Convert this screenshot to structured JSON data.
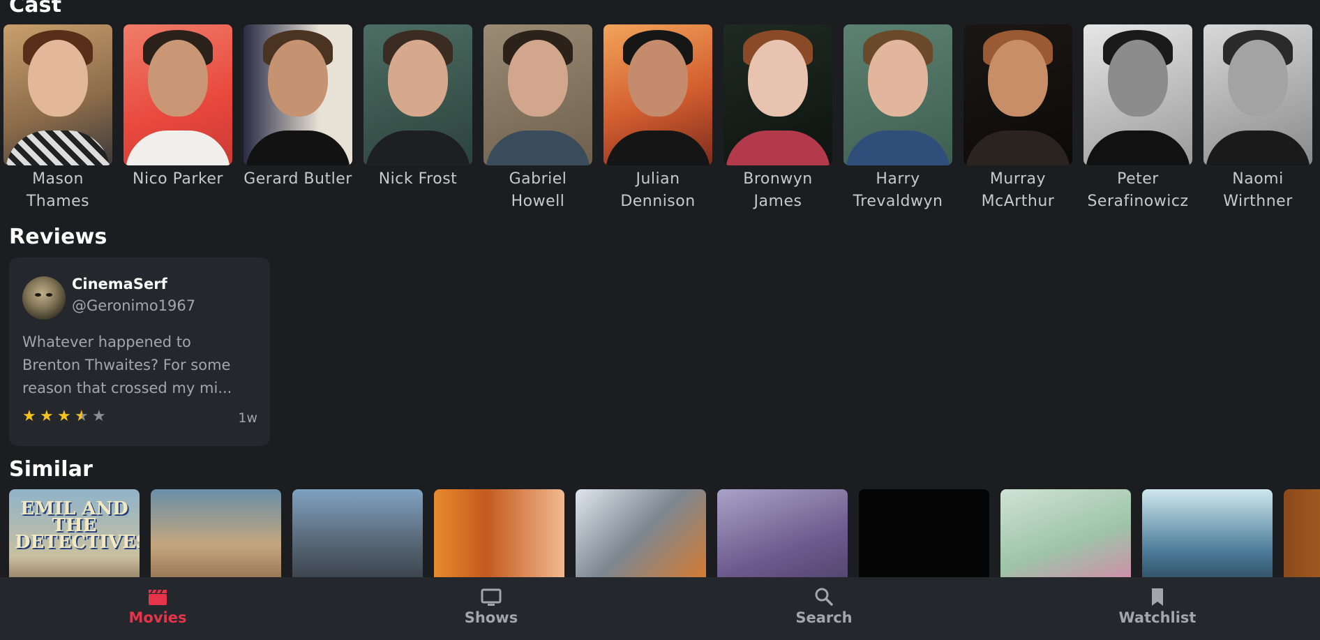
{
  "sections": {
    "cast_title": "Cast",
    "reviews_title": "Reviews",
    "similar_title": "Similar"
  },
  "cast": [
    {
      "name": "Mason Thames"
    },
    {
      "name": "Nico Parker"
    },
    {
      "name": "Gerard Butler"
    },
    {
      "name": "Nick Frost"
    },
    {
      "name": "Gabriel Howell"
    },
    {
      "name": "Julian Dennison"
    },
    {
      "name": "Bronwyn James"
    },
    {
      "name": "Harry Trevaldwyn"
    },
    {
      "name": "Murray McArthur"
    },
    {
      "name": "Peter Serafinowicz"
    },
    {
      "name": "Naomi Wirthner"
    }
  ],
  "review": {
    "author": "CinemaSerf",
    "handle": "@Geronimo1967",
    "text_lines": [
      "Whatever happened to",
      "Brenton Thwaites? For some",
      "reason that crossed my mi..."
    ],
    "rating_out_of_5": 3.5,
    "age": "1w"
  },
  "similar": [
    {
      "title_art": "EMIL AND THE DETECTIVES"
    },
    {
      "title_art": ""
    },
    {
      "title_art": ""
    },
    {
      "title_art": ""
    },
    {
      "title_art": ""
    },
    {
      "title_art": ""
    },
    {
      "title_art": ""
    },
    {
      "title_art": ""
    },
    {
      "title_art": ""
    }
  ],
  "nav": {
    "items": [
      {
        "label": "Movies",
        "icon": "clapperboard-icon",
        "active": true
      },
      {
        "label": "Shows",
        "icon": "tv-icon",
        "active": false
      },
      {
        "label": "Search",
        "icon": "search-icon",
        "active": false
      },
      {
        "label": "Watchlist",
        "icon": "bookmark-icon",
        "active": false
      }
    ]
  },
  "colors": {
    "background": "#1b1d21",
    "card": "#24272c",
    "accent": "#e8344b",
    "star": "#f6c21e"
  }
}
